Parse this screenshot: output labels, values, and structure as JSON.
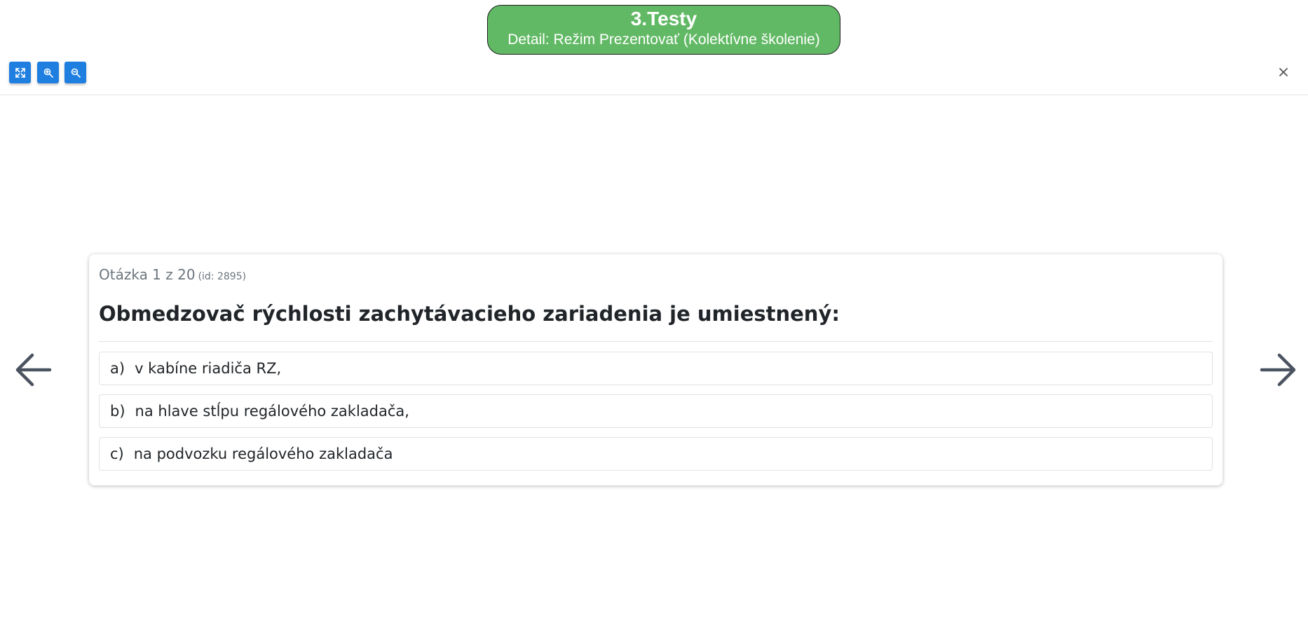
{
  "header": {
    "title": "3.Testy",
    "subtitle": "Detail: Režim Prezentovať (Kolektívne školenie)",
    "accent": "#62b965"
  },
  "toolbar": {
    "buttons": [
      {
        "name": "fullscreen-icon"
      },
      {
        "name": "zoom-in-icon"
      },
      {
        "name": "zoom-out-icon"
      }
    ],
    "close_label": "×",
    "button_color": "#1f7fe0"
  },
  "question": {
    "counter": "Otázka 1 z 20",
    "id_label": "(id: 2895)",
    "text": "Obmedzovač rýchlosti zachytávacieho zariadenia je umiestnený:",
    "answers": [
      {
        "letter": "a)",
        "text": "v kabíne riadiča RZ,"
      },
      {
        "letter": "b)",
        "text": "na hlave stĺpu regálového zakladača,"
      },
      {
        "letter": "c)",
        "text": "na podvozku regálového zakladača"
      }
    ]
  },
  "navigation": {
    "prev_icon": "arrow-left-icon",
    "next_icon": "arrow-right-icon",
    "arrow_color": "#4a5360"
  }
}
